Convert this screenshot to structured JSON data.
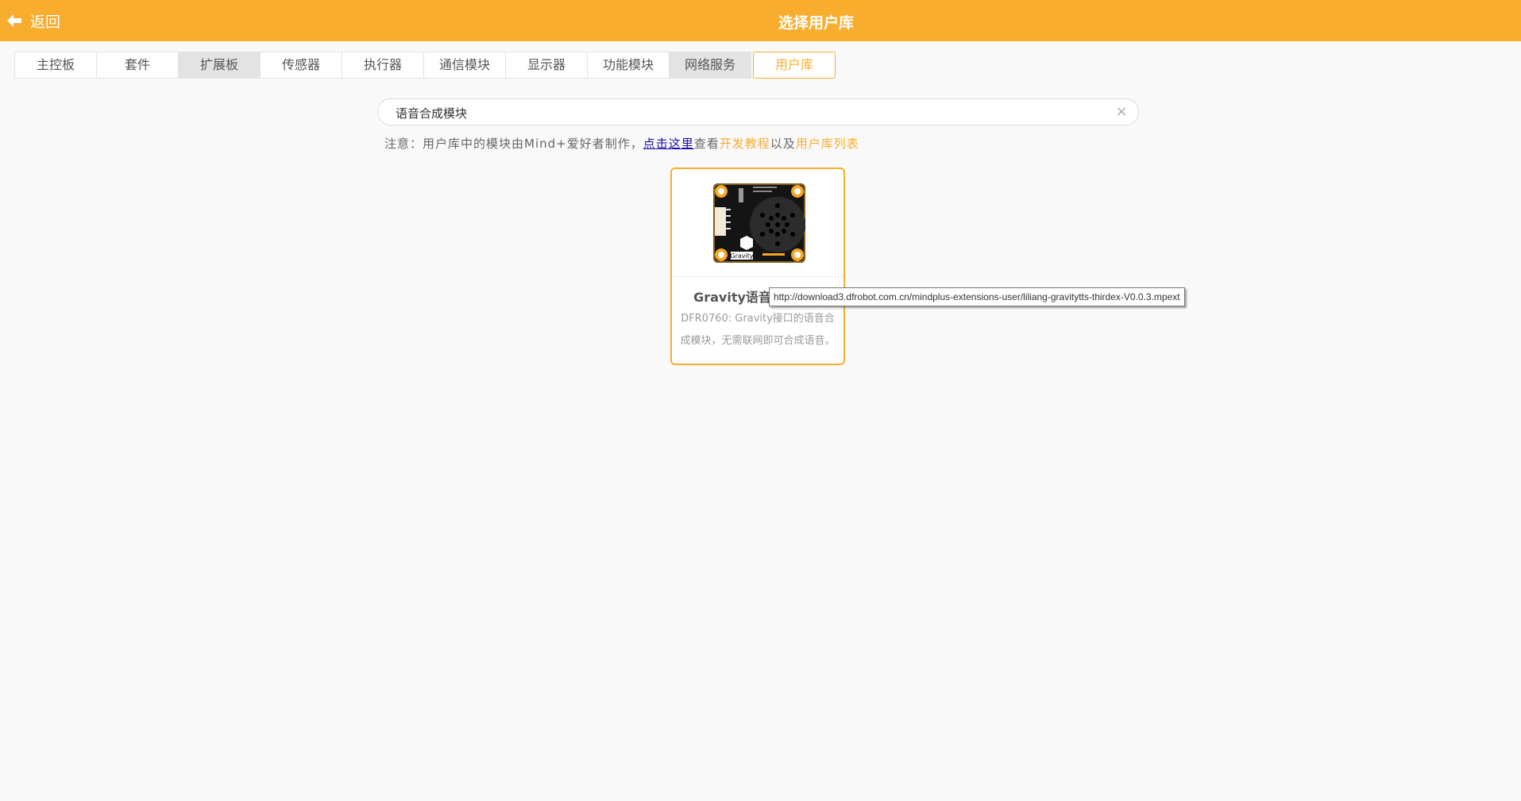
{
  "header": {
    "back_label": "返回",
    "title": "选择用户库",
    "color": "#f8ad2f"
  },
  "tabs": [
    {
      "label": "主控板",
      "state": "normal"
    },
    {
      "label": "套件",
      "state": "normal"
    },
    {
      "label": "扩展板",
      "state": "gray"
    },
    {
      "label": "传感器",
      "state": "normal"
    },
    {
      "label": "执行器",
      "state": "normal"
    },
    {
      "label": "通信模块",
      "state": "normal"
    },
    {
      "label": "显示器",
      "state": "normal"
    },
    {
      "label": "功能模块",
      "state": "normal"
    },
    {
      "label": "网络服务",
      "state": "gray"
    },
    {
      "label": "用户库",
      "state": "active"
    }
  ],
  "search": {
    "value": "语音合成模块",
    "clear_icon": "close-icon"
  },
  "notice": {
    "prefix": "注意：用户库中的模块由Mind+爱好者制作，",
    "link_here": "点击这里",
    "middle": "查看",
    "link_tutorial": "开发教程",
    "and": "以及",
    "link_list": "用户库列表"
  },
  "card": {
    "title": "Gravity语音合成模块",
    "description": "DFR0760: Gravity接口的语音合成模块，无需联网即可合成语音。",
    "image_icon": "speech-synthesis-module-image",
    "board_label": "Gravity"
  },
  "tooltip": {
    "text": "http://download3.dfrobot.com.cn/mindplus-extensions-user/liliang-gravitytts-thirdex-V0.0.3.mpext"
  }
}
